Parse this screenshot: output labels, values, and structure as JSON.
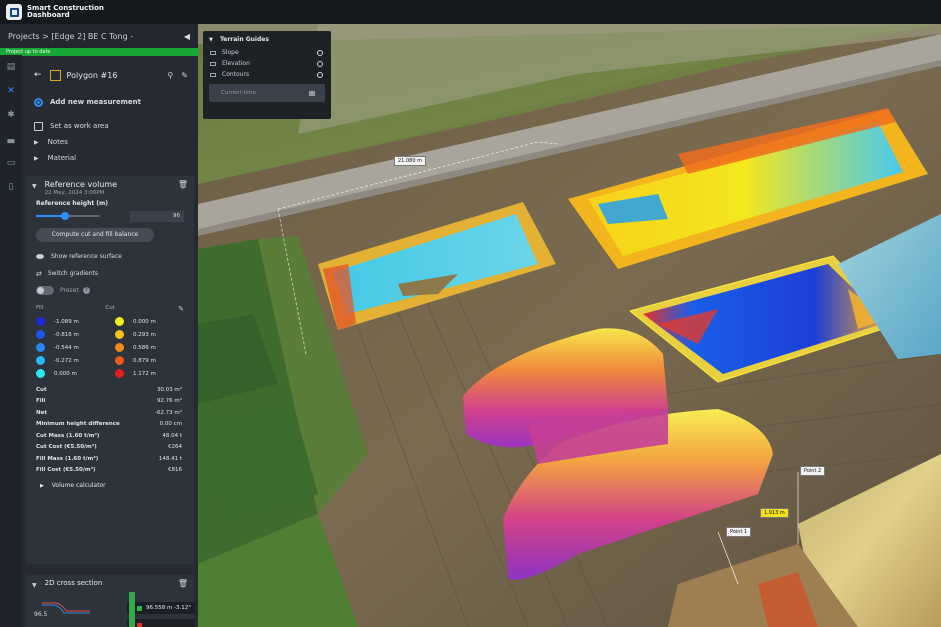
{
  "app": {
    "title": "Smart Construction Dashboard",
    "title_line1": "Smart Construction",
    "title_line2": "Dashboard"
  },
  "breadcrumb": {
    "text": "Projects > [Edge 2] BE C Tong -"
  },
  "status": {
    "text": "Project up to date"
  },
  "panel": {
    "title": "Polygon #16",
    "add_measurement": "Add new measurement",
    "set_work_area": "Set as work area",
    "notes": "Notes",
    "material": "Material"
  },
  "reference": {
    "title": "Reference volume",
    "date": "22 May, 2024 3:00PM",
    "height_label": "Reference height (m)",
    "height_value": "96",
    "slider_fraction": 0.46,
    "compute_button": "Compute cut and fill balance",
    "show_surface": "Show reference surface",
    "switch_gradients": "Switch gradients",
    "preset": "Preset"
  },
  "legend": {
    "fill_label": "Fill",
    "cut_label": "Cut",
    "fill": [
      {
        "value": "-1.089 m",
        "color": "#1f2ad8"
      },
      {
        "value": "-0.816 m",
        "color": "#1f55e6"
      },
      {
        "value": "-0.544 m",
        "color": "#2a86f2"
      },
      {
        "value": "-0.272 m",
        "color": "#29b9f6"
      },
      {
        "value": "0.000 m",
        "color": "#2ce6f2"
      }
    ],
    "cut": [
      {
        "value": "0.000 m",
        "color": "#f2ee1c"
      },
      {
        "value": "0.293 m",
        "color": "#f4c41a"
      },
      {
        "value": "0.586 m",
        "color": "#f28a16"
      },
      {
        "value": "0.879 m",
        "color": "#ec5a18"
      },
      {
        "value": "1.172 m",
        "color": "#e41c1c"
      }
    ]
  },
  "stats": [
    {
      "label": "Cut",
      "value": "30.03 m³"
    },
    {
      "label": "Fill",
      "value": "92.76 m³"
    },
    {
      "label": "Net",
      "value": "-62.73 m³"
    },
    {
      "label": "Minimum height difference",
      "value": "0.00 cm"
    },
    {
      "label": "Cut Mass (1.60 t/m³)",
      "value": "48.04 t"
    },
    {
      "label": "Cut Cost (€5.50/m³)",
      "value": "€264"
    },
    {
      "label": "Fill Mass (1.60 t/m³)",
      "value": "148.41 t"
    },
    {
      "label": "Fill Cost (€5.50/m³)",
      "value": "€816"
    }
  ],
  "volume_calculator": "Volume calculator",
  "cross_section": {
    "title": "2D cross section",
    "axis_value": "96.5",
    "chip1": {
      "value": "96.558 m",
      "right": "-3.12°",
      "color": "#2fb344"
    },
    "chip2": {
      "value": "",
      "right": "",
      "color": "#e23030"
    }
  },
  "guides": {
    "title": "Terrain Guides",
    "items": [
      "Slope",
      "Elevation",
      "Contours"
    ],
    "time_placeholder": "Current time"
  },
  "map_labels": {
    "distance": "21.080 m",
    "point2": "Point 2",
    "point1": "Point 1",
    "segment": "1.913 m"
  },
  "colors": {
    "accent": "#2c8ef8",
    "status_green": "#18a634",
    "panel_bg": "#262b32"
  }
}
